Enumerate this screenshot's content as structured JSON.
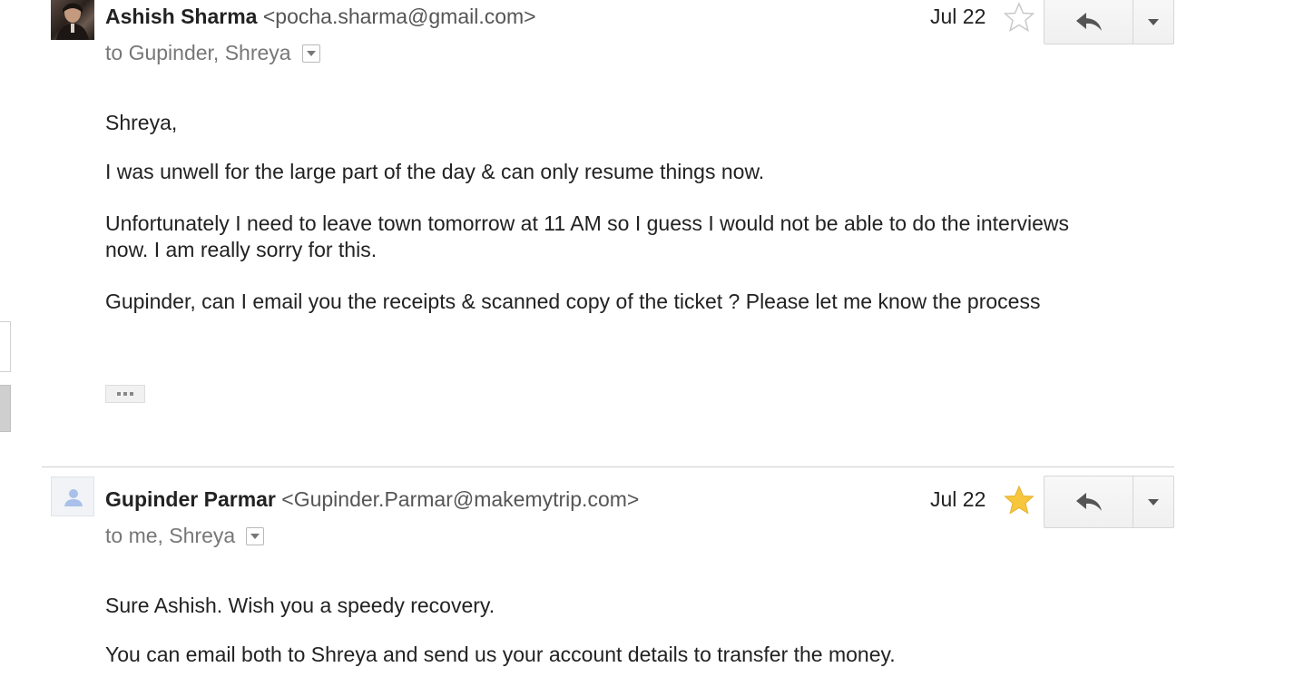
{
  "messages": [
    {
      "sender_name": "Ashish Sharma",
      "sender_email": "<pocha.sharma@gmail.com>",
      "recipients": "to Gupinder, Shreya",
      "date": "Jul 22",
      "starred": false,
      "avatar": "photo",
      "body": [
        "Shreya,",
        "I was unwell for the large part of the day & can only resume things now.",
        "Unfortunately I need to leave town tomorrow at 11 AM so I guess I would not be able to do the interviews now. I am really sorry for this.",
        "Gupinder, can I email you the receipts & scanned copy of the ticket ? Please let me know the process"
      ]
    },
    {
      "sender_name": "Gupinder Parmar",
      "sender_email": "<Gupinder.Parmar@makemytrip.com>",
      "recipients": "to me, Shreya",
      "date": "Jul 22",
      "starred": true,
      "avatar": "default-person",
      "body": [
        "Sure Ashish. Wish you a speedy recovery.",
        "You can email both to Shreya and send us your account details to transfer the money."
      ]
    }
  ],
  "icons": {
    "reply": "reply-icon",
    "more": "chevron-down-icon",
    "star_empty": "star-outline-icon",
    "star_filled": "star-filled-icon",
    "details": "chevron-down-icon",
    "trimmed": "ellipsis-icon"
  },
  "colors": {
    "star_filled": "#f7c63d",
    "star_outline": "#c8c8c8",
    "text": "#222222",
    "muted": "#777777"
  }
}
